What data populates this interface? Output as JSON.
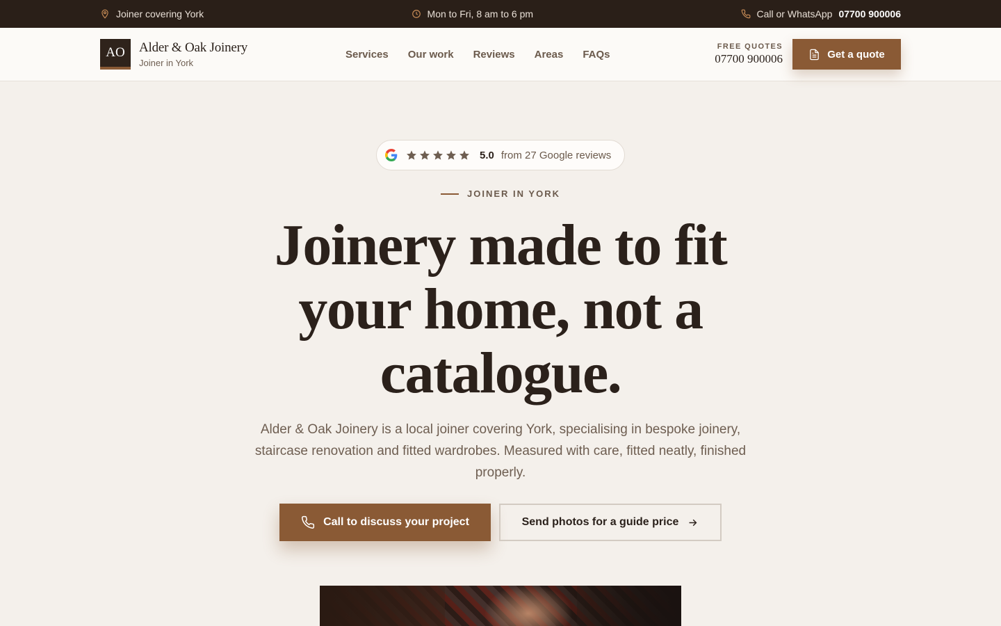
{
  "topbar": {
    "location": "Joiner covering York",
    "hours": "Mon to Fri, 8 am to 6 pm",
    "call_label": "Call or WhatsApp",
    "phone": "07700 900006"
  },
  "header": {
    "logo_initials": "AO",
    "brand_name": "Alder & Oak Joinery",
    "brand_tagline": "Joiner in York",
    "nav": [
      "Services",
      "Our work",
      "Reviews",
      "Areas",
      "FAQs"
    ],
    "free_quotes_label": "FREE QUOTES",
    "free_quotes_phone": "07700 900006",
    "quote_button": "Get a quote"
  },
  "hero": {
    "rating_score": "5.0",
    "rating_count": "from 27 Google reviews",
    "rating_stars": 5,
    "eyebrow": "JOINER IN YORK",
    "headline": "Joinery made to fit your home, not a catalogue.",
    "lede": "Alder & Oak Joinery is a local joiner covering York, specialising in bespoke joinery, staircase renovation and fitted wardrobes. Measured with care, fitted neatly, finished properly.",
    "primary_cta": "Call to discuss your project",
    "secondary_cta": "Send photos for a guide price"
  },
  "colors": {
    "accent": "#8a5a35",
    "dark": "#2a1f18",
    "background": "#f4f0eb",
    "header_bg": "#fcfaf7",
    "text_muted": "#6b5a4c"
  },
  "icons": {
    "location": "map-pin-icon",
    "hours": "clock-icon",
    "phone": "phone-icon",
    "quote": "document-icon",
    "google": "google-g-icon",
    "star": "star-icon",
    "arrow": "arrow-right-icon"
  }
}
